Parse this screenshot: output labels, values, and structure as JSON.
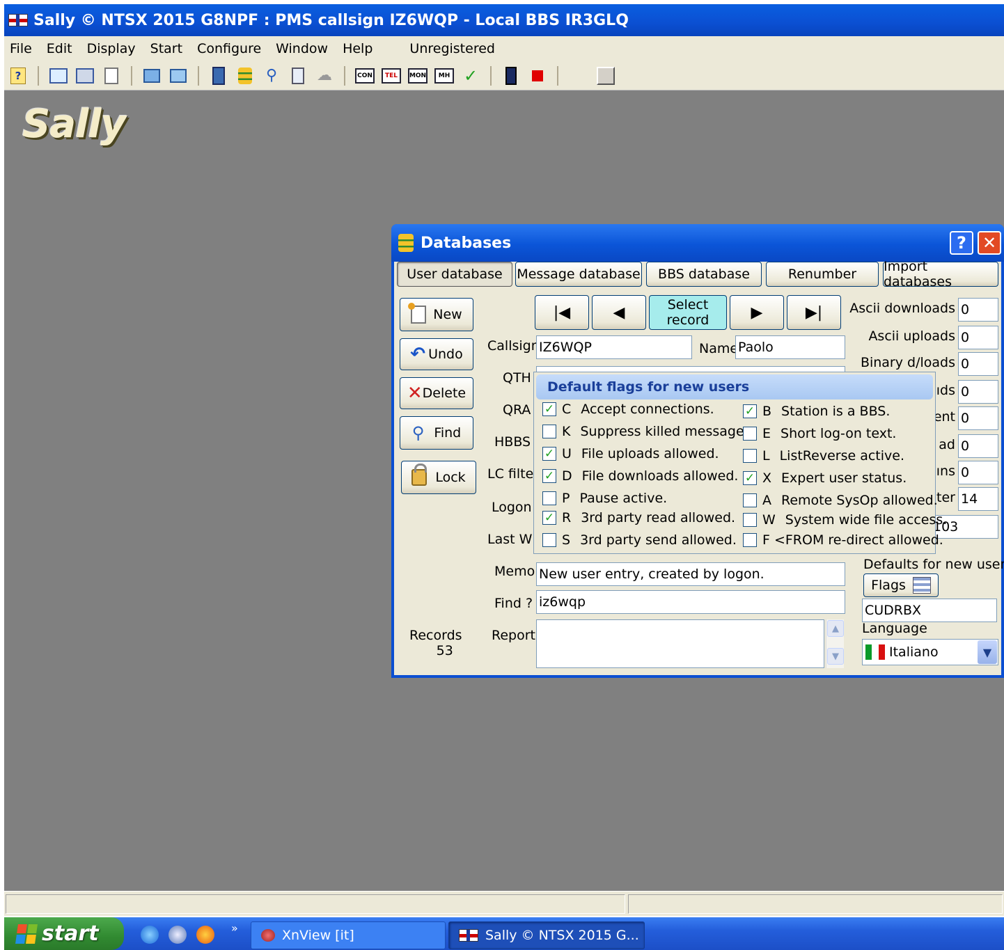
{
  "window": {
    "title": "Sally © NTSX 2015 G8NPF : PMS callsign IZ6WQP - Local BBS IR3GLQ"
  },
  "menu": {
    "items": [
      "File",
      "Edit",
      "Display",
      "Start",
      "Configure",
      "Window",
      "Help"
    ],
    "registration": "Unregistered"
  },
  "toolbar": {
    "icons": [
      "help-icon",
      "list-icon",
      "form-icon",
      "new-icon",
      "import-icon",
      "forward-icon",
      "book-icon",
      "database-icon",
      "find-icon",
      "scroll-icon",
      "cloud-icon",
      "con-icon",
      "tel-icon",
      "mon-icon",
      "mh-icon",
      "check-icon",
      "exit-icon",
      "stop-icon",
      "blank-icon"
    ],
    "labels": {
      "con": "CON",
      "tel": "TEL",
      "mon": "MON",
      "mh": "MH"
    }
  },
  "logo": "Sally",
  "dialog": {
    "title": "Databases",
    "help_label": "?",
    "close_label": "✕",
    "tabs": [
      "User database",
      "Message database",
      "BBS database",
      "Renumber",
      "Import databases"
    ],
    "active_tab": 0,
    "actions": {
      "new": "New",
      "undo": "Undo",
      "delete": "Delete",
      "find": "Find",
      "lock": "Lock"
    },
    "nav": {
      "select_line1": "Select",
      "select_line2": "record"
    },
    "fields": {
      "callsign_label": "Callsign",
      "callsign": "IZ6WQP",
      "name_label": "Name",
      "name": "Paolo",
      "qth_label": "QTH",
      "qra_label": "QRA",
      "hbbs_label": "HBBS",
      "lcfilter_label": "LC filter",
      "logon_label": "Logon",
      "lastw_label": "Last W",
      "memo_label": "Memo",
      "memo": "New user entry, created by logon.",
      "find_label": "Find ?",
      "find": "iz6wqp",
      "report_label": "Report",
      "report": ""
    },
    "records": {
      "label": "Records",
      "count": "53"
    },
    "stats": [
      {
        "label": "Ascii downloads",
        "value": "0"
      },
      {
        "label": "Ascii uploads",
        "value": "0"
      },
      {
        "label": "Binary d/loads",
        "value": "0"
      },
      {
        "label": "ıds",
        "value": "0"
      },
      {
        "label": "ent",
        "value": "0"
      },
      {
        "label": "ad",
        "value": "0"
      },
      {
        "label": "ıns",
        "value": "0"
      },
      {
        "label": "ter",
        "value": "14"
      },
      {
        "label": "",
        "value": "103"
      }
    ],
    "defaults": {
      "label": "Defaults for new users",
      "flags_button": "Flags",
      "flags_value": "CUDRBX",
      "language_label": "Language",
      "language": "Italiano"
    }
  },
  "popup": {
    "title": "Default flags for new users",
    "left": [
      {
        "code": "C",
        "text": "Accept connections.",
        "checked": true
      },
      {
        "code": "K",
        "text": "Suppress killed messages.",
        "checked": false
      },
      {
        "code": "U",
        "text": "File uploads allowed.",
        "checked": true
      },
      {
        "code": "D",
        "text": "File downloads allowed.",
        "checked": true
      },
      {
        "code": "P",
        "text": "Pause active.",
        "checked": false
      },
      {
        "code": "R",
        "text": "3rd party read allowed.",
        "checked": true
      },
      {
        "code": "S",
        "text": "3rd party send allowed.",
        "checked": false
      }
    ],
    "right": [
      {
        "code": "B",
        "text": "Station is a BBS.",
        "checked": true
      },
      {
        "code": "E",
        "text": "Short log-on text.",
        "checked": false
      },
      {
        "code": "L",
        "text": "ListReverse active.",
        "checked": false
      },
      {
        "code": "X",
        "text": "Expert user status.",
        "checked": true
      },
      {
        "code": "A",
        "text": "Remote SysOp allowed.",
        "checked": false
      },
      {
        "code": "W",
        "text": "System wide file access.",
        "checked": false
      },
      {
        "code": "F",
        "text": "<FROM re-direct allowed.",
        "checked": false
      }
    ]
  },
  "taskbar": {
    "start": "start",
    "tasks": [
      "XnView [it]",
      "Sally © NTSX 2015 G..."
    ],
    "overflow": "»"
  },
  "colors": {
    "titlebar": "#0b4fd2",
    "desktop": "#808080",
    "checkmark": "#21a121",
    "select_record_bg": "#a6ecec"
  }
}
